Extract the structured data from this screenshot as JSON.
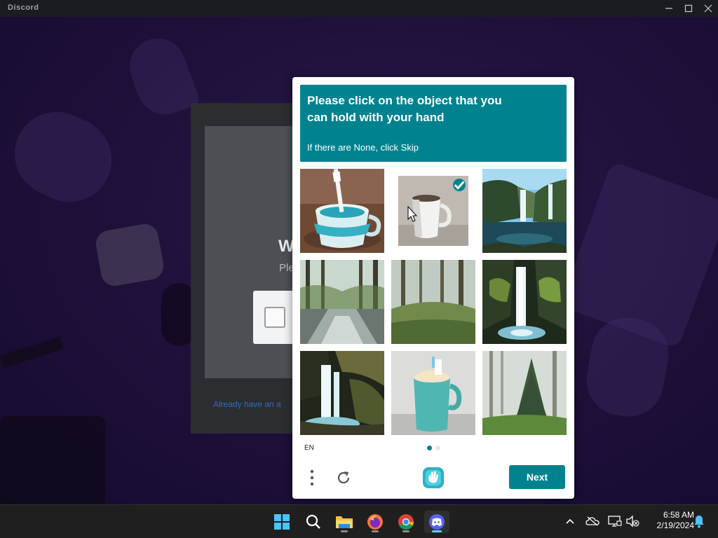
{
  "window": {
    "title": "Discord"
  },
  "discord": {
    "heading": "W",
    "subtitle": "Ple",
    "link": "Already have an a"
  },
  "challenge": {
    "prompt_title": "Please click on the object that you can hold with your hand",
    "prompt_subtitle": "If there are None, click Skip",
    "tiles": [
      {
        "name": "tile-toothbrush-cup",
        "selected": false
      },
      {
        "name": "tile-white-mug",
        "selected": true
      },
      {
        "name": "tile-waterfall-lake",
        "selected": false
      },
      {
        "name": "tile-forest-stream",
        "selected": false
      },
      {
        "name": "tile-misty-forest",
        "selected": false
      },
      {
        "name": "tile-waterfall-rocks",
        "selected": false
      },
      {
        "name": "tile-waterfall-cave",
        "selected": false
      },
      {
        "name": "tile-teal-mug-toothbrush",
        "selected": false
      },
      {
        "name": "tile-foggy-pine-forest",
        "selected": false
      }
    ],
    "language": "EN",
    "page_indicator": {
      "current": 1,
      "total": 2
    },
    "next_label": "Next",
    "accent_color": "#00838f"
  },
  "taskbar": {
    "apps": [
      "start-button",
      "search",
      "file-explorer",
      "firefox",
      "chrome",
      "discord"
    ],
    "clock_time": "6:58 AM",
    "clock_date": "2/19/2024"
  }
}
